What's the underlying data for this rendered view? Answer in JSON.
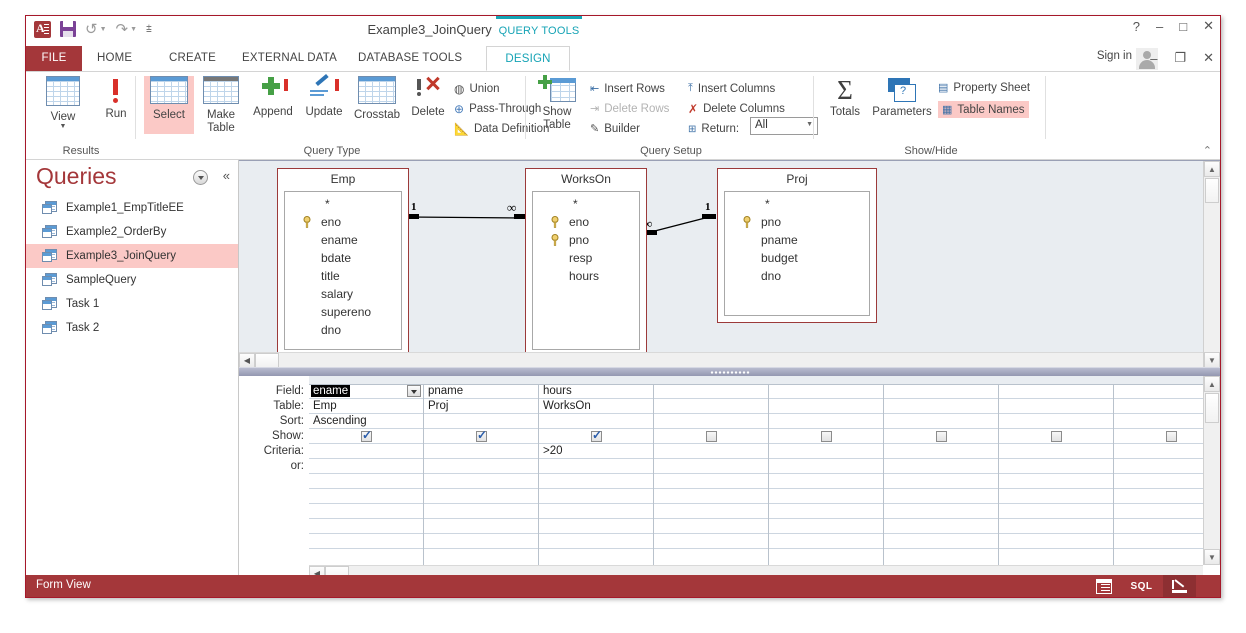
{
  "window": {
    "title": "Example3_JoinQuery - Access",
    "contextual_tab_group": "QUERY TOOLS",
    "sign_in": "Sign in",
    "help": "?",
    "minimize": "–",
    "maximize": "□",
    "close": "✕",
    "restore": "❐"
  },
  "quick_access": {
    "logo": "access-logo",
    "save": "save-icon",
    "undo": "↺",
    "redo": "↻",
    "customize": "⇟"
  },
  "tabs": [
    {
      "label": "FILE",
      "active": false
    },
    {
      "label": "HOME",
      "active": false
    },
    {
      "label": "CREATE",
      "active": false
    },
    {
      "label": "EXTERNAL DATA",
      "active": false
    },
    {
      "label": "DATABASE TOOLS",
      "active": false
    },
    {
      "label": "DESIGN",
      "active": true
    }
  ],
  "ribbon": {
    "groups": [
      {
        "name": "Results"
      },
      {
        "name": "Query Type"
      },
      {
        "name": "Query Setup"
      },
      {
        "name": "Show/Hide"
      }
    ],
    "results": [
      {
        "label": "View",
        "has_dropdown": true
      },
      {
        "label": "Run"
      }
    ],
    "query_type": [
      {
        "label": "Select",
        "highlighted": true
      },
      {
        "label": "Make Table"
      },
      {
        "label": "Append"
      },
      {
        "label": "Update"
      },
      {
        "label": "Crosstab"
      },
      {
        "label": "Delete"
      }
    ],
    "query_type_small": [
      {
        "label": "Union"
      },
      {
        "label": "Pass-Through"
      },
      {
        "label": "Data Definition"
      }
    ],
    "query_setup_big": {
      "label": "Show Table"
    },
    "query_setup_small": [
      {
        "label": "Insert Rows",
        "disabled": false
      },
      {
        "label": "Delete Rows",
        "disabled": true
      },
      {
        "label": "Builder",
        "disabled": false
      },
      {
        "label": "Insert Columns",
        "disabled": false
      },
      {
        "label": "Delete Columns",
        "disabled": false
      },
      {
        "label": "Return:",
        "disabled": false
      }
    ],
    "return_value": "All",
    "show_hide_big": [
      {
        "label": "Totals"
      },
      {
        "label": "Parameters"
      }
    ],
    "show_hide_small": [
      {
        "label": "Property Sheet",
        "highlighted": false
      },
      {
        "label": "Table Names",
        "highlighted": true
      }
    ],
    "collapse": "⌃"
  },
  "nav_pane": {
    "title": "Queries",
    "items": [
      {
        "label": "Example1_EmpTitleEE",
        "selected": false
      },
      {
        "label": "Example2_OrderBy",
        "selected": false
      },
      {
        "label": "Example3_JoinQuery",
        "selected": true
      },
      {
        "label": "SampleQuery",
        "selected": false
      },
      {
        "label": "Task 1",
        "selected": false
      },
      {
        "label": "Task 2",
        "selected": false
      }
    ]
  },
  "diagram": {
    "tables": [
      {
        "name": "Emp",
        "fields": [
          {
            "name": "*",
            "key": false
          },
          {
            "name": "eno",
            "key": true
          },
          {
            "name": "ename",
            "key": false
          },
          {
            "name": "bdate",
            "key": false
          },
          {
            "name": "title",
            "key": false
          },
          {
            "name": "salary",
            "key": false
          },
          {
            "name": "supereno",
            "key": false
          },
          {
            "name": "dno",
            "key": false
          }
        ]
      },
      {
        "name": "WorksOn",
        "fields": [
          {
            "name": "*",
            "key": false
          },
          {
            "name": "eno",
            "key": true
          },
          {
            "name": "pno",
            "key": true
          },
          {
            "name": "resp",
            "key": false
          },
          {
            "name": "hours",
            "key": false
          }
        ]
      },
      {
        "name": "Proj",
        "fields": [
          {
            "name": "*",
            "key": false
          },
          {
            "name": "pno",
            "key": true
          },
          {
            "name": "pname",
            "key": false
          },
          {
            "name": "budget",
            "key": false
          },
          {
            "name": "dno",
            "key": false
          }
        ]
      }
    ],
    "relationships": [
      {
        "from": "Emp",
        "to": "WorksOn",
        "from_card": "1",
        "to_card": "∞"
      },
      {
        "from": "WorksOn",
        "to": "Proj",
        "from_card": "∞",
        "to_card": "1"
      }
    ]
  },
  "qbe": {
    "row_labels": [
      "Field:",
      "Table:",
      "Sort:",
      "Show:",
      "Criteria:",
      "or:"
    ],
    "columns": [
      {
        "field": "ename",
        "table": "Emp",
        "sort": "Ascending",
        "show": true,
        "criteria": "",
        "or": "",
        "selected": true
      },
      {
        "field": "pname",
        "table": "Proj",
        "sort": "",
        "show": true,
        "criteria": "",
        "or": "",
        "selected": false
      },
      {
        "field": "hours",
        "table": "WorksOn",
        "sort": "",
        "show": true,
        "criteria": ">20",
        "or": "",
        "selected": false
      },
      {
        "field": "",
        "table": "",
        "sort": "",
        "show": false,
        "criteria": "",
        "or": "",
        "selected": false
      },
      {
        "field": "",
        "table": "",
        "sort": "",
        "show": false,
        "criteria": "",
        "or": "",
        "selected": false
      },
      {
        "field": "",
        "table": "",
        "sort": "",
        "show": false,
        "criteria": "",
        "or": "",
        "selected": false
      },
      {
        "field": "",
        "table": "",
        "sort": "",
        "show": false,
        "criteria": "",
        "or": "",
        "selected": false
      },
      {
        "field": "",
        "table": "",
        "sort": "",
        "show": false,
        "criteria": "",
        "or": "",
        "selected": false
      }
    ]
  },
  "status_bar": {
    "text": "Form View",
    "views": [
      {
        "name": "datasheet-view",
        "label": "",
        "active": false
      },
      {
        "name": "sql-view",
        "label": "SQL",
        "active": false
      },
      {
        "name": "design-view",
        "label": "",
        "active": true
      }
    ]
  }
}
